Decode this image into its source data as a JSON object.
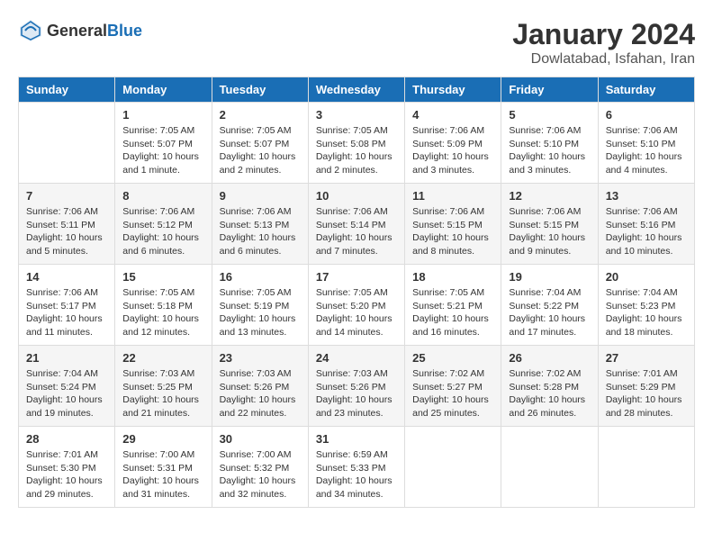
{
  "header": {
    "logo_general": "General",
    "logo_blue": "Blue",
    "month": "January 2024",
    "location": "Dowlatabad, Isfahan, Iran"
  },
  "days_of_week": [
    "Sunday",
    "Monday",
    "Tuesday",
    "Wednesday",
    "Thursday",
    "Friday",
    "Saturday"
  ],
  "weeks": [
    [
      {
        "day": "",
        "info": ""
      },
      {
        "day": "1",
        "info": "Sunrise: 7:05 AM\nSunset: 5:07 PM\nDaylight: 10 hours\nand 1 minute."
      },
      {
        "day": "2",
        "info": "Sunrise: 7:05 AM\nSunset: 5:07 PM\nDaylight: 10 hours\nand 2 minutes."
      },
      {
        "day": "3",
        "info": "Sunrise: 7:05 AM\nSunset: 5:08 PM\nDaylight: 10 hours\nand 2 minutes."
      },
      {
        "day": "4",
        "info": "Sunrise: 7:06 AM\nSunset: 5:09 PM\nDaylight: 10 hours\nand 3 minutes."
      },
      {
        "day": "5",
        "info": "Sunrise: 7:06 AM\nSunset: 5:10 PM\nDaylight: 10 hours\nand 3 minutes."
      },
      {
        "day": "6",
        "info": "Sunrise: 7:06 AM\nSunset: 5:10 PM\nDaylight: 10 hours\nand 4 minutes."
      }
    ],
    [
      {
        "day": "7",
        "info": "Sunrise: 7:06 AM\nSunset: 5:11 PM\nDaylight: 10 hours\nand 5 minutes."
      },
      {
        "day": "8",
        "info": "Sunrise: 7:06 AM\nSunset: 5:12 PM\nDaylight: 10 hours\nand 6 minutes."
      },
      {
        "day": "9",
        "info": "Sunrise: 7:06 AM\nSunset: 5:13 PM\nDaylight: 10 hours\nand 6 minutes."
      },
      {
        "day": "10",
        "info": "Sunrise: 7:06 AM\nSunset: 5:14 PM\nDaylight: 10 hours\nand 7 minutes."
      },
      {
        "day": "11",
        "info": "Sunrise: 7:06 AM\nSunset: 5:15 PM\nDaylight: 10 hours\nand 8 minutes."
      },
      {
        "day": "12",
        "info": "Sunrise: 7:06 AM\nSunset: 5:15 PM\nDaylight: 10 hours\nand 9 minutes."
      },
      {
        "day": "13",
        "info": "Sunrise: 7:06 AM\nSunset: 5:16 PM\nDaylight: 10 hours\nand 10 minutes."
      }
    ],
    [
      {
        "day": "14",
        "info": "Sunrise: 7:06 AM\nSunset: 5:17 PM\nDaylight: 10 hours\nand 11 minutes."
      },
      {
        "day": "15",
        "info": "Sunrise: 7:05 AM\nSunset: 5:18 PM\nDaylight: 10 hours\nand 12 minutes."
      },
      {
        "day": "16",
        "info": "Sunrise: 7:05 AM\nSunset: 5:19 PM\nDaylight: 10 hours\nand 13 minutes."
      },
      {
        "day": "17",
        "info": "Sunrise: 7:05 AM\nSunset: 5:20 PM\nDaylight: 10 hours\nand 14 minutes."
      },
      {
        "day": "18",
        "info": "Sunrise: 7:05 AM\nSunset: 5:21 PM\nDaylight: 10 hours\nand 16 minutes."
      },
      {
        "day": "19",
        "info": "Sunrise: 7:04 AM\nSunset: 5:22 PM\nDaylight: 10 hours\nand 17 minutes."
      },
      {
        "day": "20",
        "info": "Sunrise: 7:04 AM\nSunset: 5:23 PM\nDaylight: 10 hours\nand 18 minutes."
      }
    ],
    [
      {
        "day": "21",
        "info": "Sunrise: 7:04 AM\nSunset: 5:24 PM\nDaylight: 10 hours\nand 19 minutes."
      },
      {
        "day": "22",
        "info": "Sunrise: 7:03 AM\nSunset: 5:25 PM\nDaylight: 10 hours\nand 21 minutes."
      },
      {
        "day": "23",
        "info": "Sunrise: 7:03 AM\nSunset: 5:26 PM\nDaylight: 10 hours\nand 22 minutes."
      },
      {
        "day": "24",
        "info": "Sunrise: 7:03 AM\nSunset: 5:26 PM\nDaylight: 10 hours\nand 23 minutes."
      },
      {
        "day": "25",
        "info": "Sunrise: 7:02 AM\nSunset: 5:27 PM\nDaylight: 10 hours\nand 25 minutes."
      },
      {
        "day": "26",
        "info": "Sunrise: 7:02 AM\nSunset: 5:28 PM\nDaylight: 10 hours\nand 26 minutes."
      },
      {
        "day": "27",
        "info": "Sunrise: 7:01 AM\nSunset: 5:29 PM\nDaylight: 10 hours\nand 28 minutes."
      }
    ],
    [
      {
        "day": "28",
        "info": "Sunrise: 7:01 AM\nSunset: 5:30 PM\nDaylight: 10 hours\nand 29 minutes."
      },
      {
        "day": "29",
        "info": "Sunrise: 7:00 AM\nSunset: 5:31 PM\nDaylight: 10 hours\nand 31 minutes."
      },
      {
        "day": "30",
        "info": "Sunrise: 7:00 AM\nSunset: 5:32 PM\nDaylight: 10 hours\nand 32 minutes."
      },
      {
        "day": "31",
        "info": "Sunrise: 6:59 AM\nSunset: 5:33 PM\nDaylight: 10 hours\nand 34 minutes."
      },
      {
        "day": "",
        "info": ""
      },
      {
        "day": "",
        "info": ""
      },
      {
        "day": "",
        "info": ""
      }
    ]
  ]
}
